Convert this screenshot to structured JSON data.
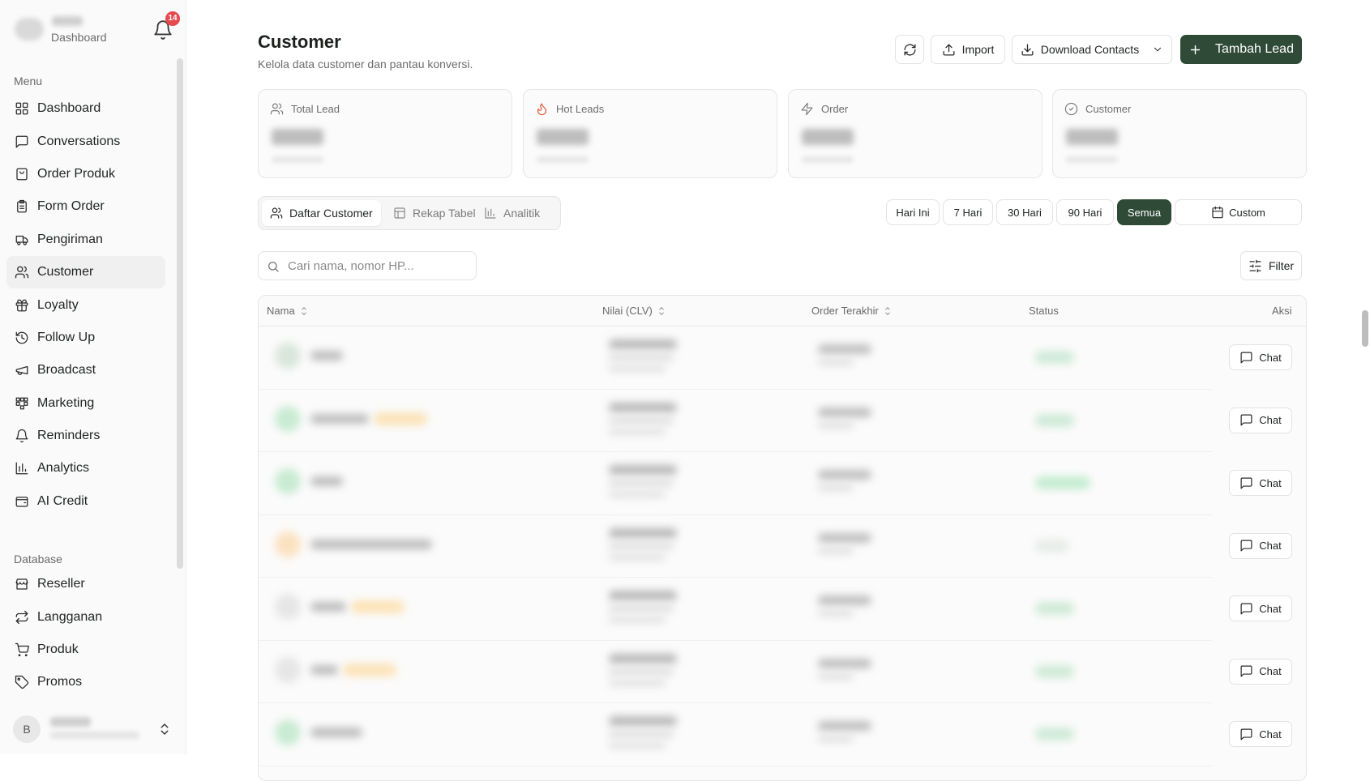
{
  "sidebar": {
    "subtitle": "Dashboard",
    "notification_count": "14",
    "section_menu": "Menu",
    "menu": [
      {
        "label": "Dashboard",
        "icon": "dashboard-icon"
      },
      {
        "label": "Conversations",
        "icon": "message-square-icon"
      },
      {
        "label": "Order Produk",
        "icon": "shopping-bag-icon"
      },
      {
        "label": "Form Order",
        "icon": "clipboard-list-icon"
      },
      {
        "label": "Pengiriman",
        "icon": "truck-icon"
      },
      {
        "label": "Customer",
        "icon": "users-icon",
        "active": true
      },
      {
        "label": "Loyalty",
        "icon": "gift-icon"
      },
      {
        "label": "Follow Up",
        "icon": "history-icon"
      },
      {
        "label": "Broadcast",
        "icon": "megaphone-icon"
      },
      {
        "label": "Marketing",
        "icon": "grid-icon"
      },
      {
        "label": "Reminders",
        "icon": "bell-icon"
      },
      {
        "label": "Analytics",
        "icon": "bar-chart-icon"
      },
      {
        "label": "AI Credit",
        "icon": "wallet-icon"
      }
    ],
    "section_database": "Database",
    "database": [
      {
        "label": "Reseller",
        "icon": "store-icon"
      },
      {
        "label": "Langganan",
        "icon": "repeat-icon"
      },
      {
        "label": "Produk",
        "icon": "cart-icon"
      },
      {
        "label": "Promos",
        "icon": "tag-icon"
      }
    ],
    "user_initial": "B"
  },
  "header": {
    "title": "Customer",
    "subtitle": "Kelola data customer dan pantau konversi.",
    "import_label": "Import",
    "download_label": "Download Contacts",
    "add_label": "Tambah Lead"
  },
  "stats": [
    {
      "label": "Total Lead",
      "icon": "users-icon"
    },
    {
      "label": "Hot Leads",
      "icon": "flame-icon"
    },
    {
      "label": "Order",
      "icon": "zap-icon"
    },
    {
      "label": "Customer",
      "icon": "check-circle-icon"
    }
  ],
  "tabs": [
    {
      "label": "Daftar Customer",
      "icon": "users-icon",
      "active": true
    },
    {
      "label": "Rekap Tabel",
      "icon": "table-icon"
    },
    {
      "label": "Analitik",
      "icon": "bar-chart-icon"
    }
  ],
  "ranges": [
    {
      "label": "Hari Ini"
    },
    {
      "label": "7 Hari"
    },
    {
      "label": "30 Hari"
    },
    {
      "label": "90 Hari"
    },
    {
      "label": "Semua",
      "active": true
    },
    {
      "label": "Custom",
      "icon": "calendar-icon"
    }
  ],
  "search": {
    "placeholder": "Cari nama, nomor HP..."
  },
  "filter_label": "Filter",
  "table": {
    "columns": [
      "Nama",
      "Nilai (CLV)",
      "Order Terakhir",
      "Status",
      "Aksi"
    ],
    "chat_label": "Chat",
    "row_count": 7
  },
  "colors": {
    "primary": "#2f4a36",
    "badge": "#e5484d",
    "flame": "#e0593a"
  }
}
